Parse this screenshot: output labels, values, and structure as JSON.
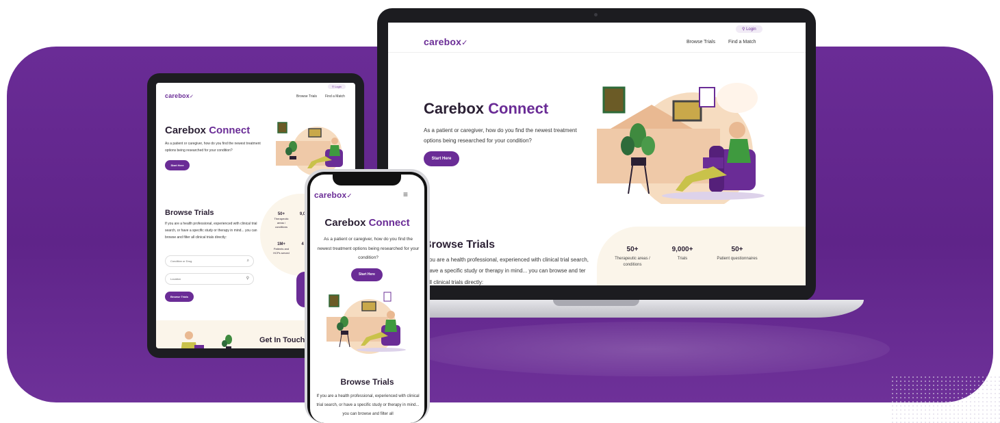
{
  "laptop": {
    "logo": "carebox",
    "logo_mark": "✓",
    "nav": {
      "login": "Login",
      "browse_trials": "Browse Trials",
      "find_match": "Find a Match"
    },
    "hero": {
      "title_a": "Carebox ",
      "title_b": "Connect",
      "subtitle": "As a patient or caregiver, how do you find the newest treatment options being researched for your condition?",
      "cta": "Start Here"
    },
    "browse": {
      "title": "Browse Trials",
      "text": "you are a health professional, experienced with clinical trial search, have a specific study or therapy in mind... you can browse and ter all clinical trials directly:"
    },
    "stats": [
      {
        "value": "50+",
        "label": "Therapeutic areas / conditions"
      },
      {
        "value": "9,000+",
        "label": "Trials"
      },
      {
        "value": "50+",
        "label": "Patient questionnaires"
      }
    ]
  },
  "tablet": {
    "logo": "carebox",
    "nav": {
      "login": "Login",
      "browse_trials": "Browse Trials",
      "find_match": "Find a Match"
    },
    "hero": {
      "title_a": "Carebox ",
      "title_b": "Connect",
      "subtitle": "As a patient or caregiver, how do you find the newest treatment options being researched for your condition?",
      "cta": "Start Here"
    },
    "browse": {
      "title": "Browse Trials",
      "text": "If you are a health professional, experienced with clinical trial search, or have a specific study or therapy in mind... you can browse and filter all clinical trials directly:",
      "input1": "Condition or Drug",
      "input2": "Location",
      "button": "Browse Trials"
    },
    "stats": [
      {
        "value": "50+",
        "label": "Therapeutic areas / conditions"
      },
      {
        "value": "9,0",
        "label": ""
      },
      {
        "value": "1M+",
        "label": "Patients and HCPs served"
      },
      {
        "value": "4",
        "label": ""
      }
    ],
    "footer": {
      "title": "Get In Touch"
    }
  },
  "phone": {
    "logo": "carebox",
    "menu": "≡",
    "hero": {
      "title_a": "Carebox ",
      "title_b": "Connect",
      "subtitle": "As a patient or caregiver, how do you find the newest treatment options being researched for your condition?",
      "cta": "Start Here"
    },
    "browse": {
      "title": "Browse Trials",
      "text": "If you are a health professional, experienced with clinical trial search, or have a specific study or therapy in mind... you can browse and filter all"
    }
  },
  "colors": {
    "brand": "#6a2c96",
    "cream": "#fbf5ea",
    "ink": "#2a1f33"
  }
}
